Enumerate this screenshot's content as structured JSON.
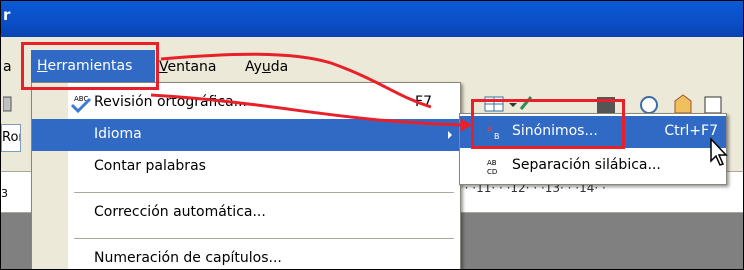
{
  "window": {
    "title_fragment": "r"
  },
  "menubar": {
    "cut_label": "a",
    "herramientas_label": "Herramientas",
    "ventana_label": "Ventana",
    "ayuda_label": "Ayuda"
  },
  "toolbar": {
    "font_fragment": "Ror"
  },
  "ruler": {
    "left_number": "3",
    "right_markers": "· · ·11· · ·12· · ·13· · ·14· ·"
  },
  "tools_menu": {
    "items": [
      {
        "label": "Revisión ortográfica...",
        "shortcut": "F7"
      },
      {
        "label": "Idioma",
        "shortcut": ""
      },
      {
        "label": "Contar palabras",
        "shortcut": ""
      },
      {
        "label": "Corrección automática...",
        "shortcut": ""
      },
      {
        "label": "Numeración de capítulos...",
        "shortcut": ""
      }
    ]
  },
  "idioma_submenu": {
    "items": [
      {
        "label": "Sinónimos...",
        "shortcut": "Ctrl+F7"
      },
      {
        "label": "Separación silábica...",
        "shortcut": ""
      }
    ]
  },
  "colors": {
    "highlight": "#316ac5",
    "annotation": "#e8202a",
    "menubg": "#ece9d8"
  }
}
